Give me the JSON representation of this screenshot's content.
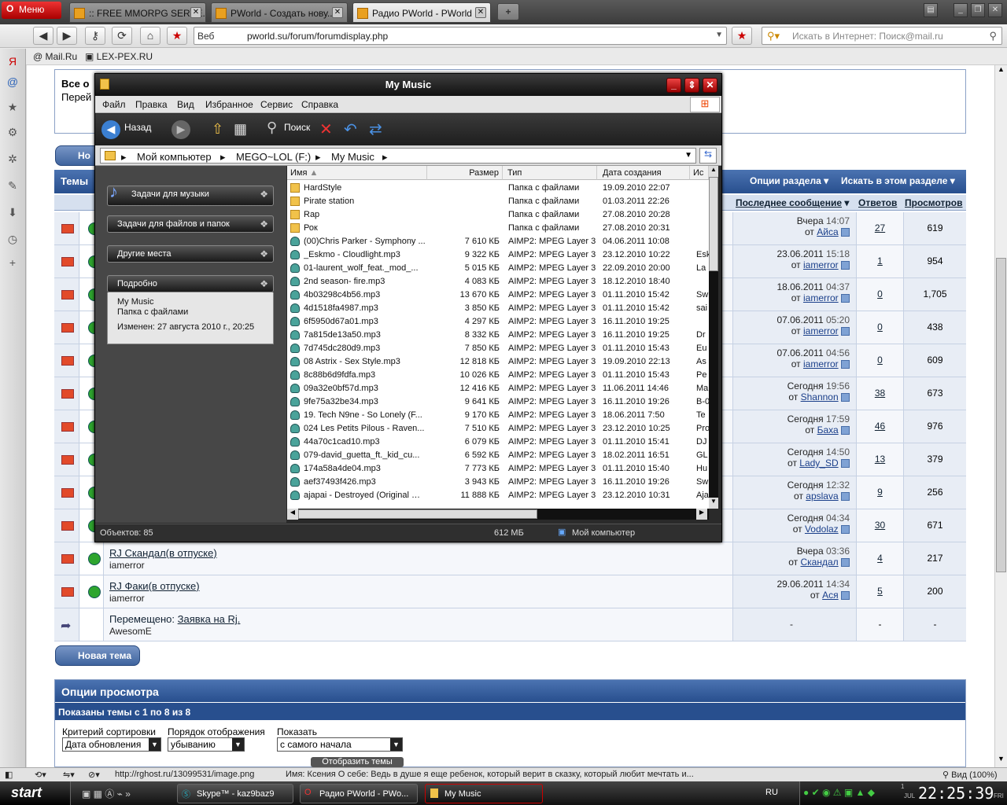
{
  "browser": {
    "menu_label": "Меню",
    "tabs": [
      {
        "label": ":: FREE MMORPG SERVE..."
      },
      {
        "label": "PWorld - Создать нову..."
      },
      {
        "label": "Радио PWorld - PWorld"
      }
    ],
    "url_prefix": "Веб",
    "url": "pworld.su/forum/forumdisplay.php",
    "search_placeholder": "Искать в Интернет: Поиск@mail.ru",
    "bookmarks": [
      "Mail.Ru",
      "LEX-PEX.RU"
    ]
  },
  "forum": {
    "notice_line1": "Все о",
    "notice_line2": "Перей",
    "threads_head_label": "Темы",
    "new_thread_partial": "Но",
    "section_options": "Опции раздела",
    "search_section": "Искать в этом разделе",
    "col_last_post": "Последнее сообщение",
    "col_replies": "Ответов",
    "col_views": "Просмотров",
    "rows": [
      {
        "title": "",
        "author": "",
        "date": "Вчера",
        "time": "14:07",
        "by_prefix": "от",
        "by": "Айса",
        "replies": "27",
        "views": "619"
      },
      {
        "title": "",
        "author": "",
        "date": "23.06.2011",
        "time": "15:18",
        "by_prefix": "от",
        "by": "iamerror",
        "replies": "1",
        "views": "954"
      },
      {
        "title": "",
        "author": "",
        "date": "18.06.2011",
        "time": "04:37",
        "by_prefix": "от",
        "by": "iamerror",
        "replies": "0",
        "views": "1,705"
      },
      {
        "title": "",
        "author": "",
        "date": "07.06.2011",
        "time": "05:20",
        "by_prefix": "от",
        "by": "iamerror",
        "replies": "0",
        "views": "438"
      },
      {
        "title": "",
        "author": "",
        "date": "07.06.2011",
        "time": "04:56",
        "by_prefix": "от",
        "by": "iamerror",
        "replies": "0",
        "views": "609"
      },
      {
        "title": "",
        "author": "",
        "date": "Сегодня",
        "time": "19:56",
        "by_prefix": "от",
        "by": "Shannon",
        "replies": "38",
        "views": "673"
      },
      {
        "title": "",
        "author": "",
        "date": "Сегодня",
        "time": "17:59",
        "by_prefix": "от",
        "by": "Баха",
        "replies": "46",
        "views": "976"
      },
      {
        "title": "",
        "author": "",
        "date": "Сегодня",
        "time": "14:50",
        "by_prefix": "от",
        "by": "Lady_SD",
        "replies": "13",
        "views": "379"
      },
      {
        "title": "",
        "author": "",
        "date": "Сегодня",
        "time": "12:32",
        "by_prefix": "от",
        "by": "apslava",
        "replies": "9",
        "views": "256"
      },
      {
        "title": "",
        "author": "",
        "date": "Сегодня",
        "time": "04:34",
        "by_prefix": "от",
        "by": "Vodolaz",
        "replies": "30",
        "views": "671"
      },
      {
        "title": "RJ Скандал(в отпуске)",
        "author": "iamerror",
        "date": "Вчера",
        "time": "03:36",
        "by_prefix": "от",
        "by": "Скандал",
        "replies": "4",
        "views": "217"
      },
      {
        "title": "RJ Факи(в отпуске)",
        "author": "iamerror",
        "date": "29.06.2011",
        "time": "14:34",
        "by_prefix": "от",
        "by": "Ася",
        "replies": "5",
        "views": "200"
      }
    ],
    "moved_prefix": "Перемещено:",
    "moved_title": "Заявка на Rj.",
    "moved_author": "AwesomE",
    "moved_dash": "-",
    "new_thread_button": "Новая тема",
    "view_options_title": "Опции просмотра",
    "shown_threads": "Показаны темы с 1 по 8 из 8",
    "sort_label": "Критерий сортировки",
    "sort_value": "Дата обновления",
    "order_label": "Порядок отображения",
    "order_value": "убыванию",
    "show_label": "Показать",
    "show_value": "с самого начала",
    "show_button": "Отобразить темы"
  },
  "explorer": {
    "title": "My Music",
    "menu": [
      "Файл",
      "Правка",
      "Вид",
      "Избранное",
      "Сервис",
      "Справка"
    ],
    "back_label": "Назад",
    "search_label": "Поиск",
    "breadcrumbs": [
      "Мой компьютер",
      "MEGO~LOL (F:)",
      "My Music"
    ],
    "tasks": [
      "Задачи для музыки",
      "Задачи для файлов и папок",
      "Другие места",
      "Подробно"
    ],
    "detail_name": "My Music",
    "detail_type": "Папка с файлами",
    "detail_modified": "Изменен: 27 августа 2010 г., 20:25",
    "columns": {
      "name": "Имя",
      "size": "Размер",
      "type": "Тип",
      "created": "Дата создания",
      "extra": "Ис"
    },
    "files": [
      {
        "icon": "folder",
        "name": "HardStyle",
        "size": "",
        "type": "Папка с файлами",
        "created": "19.09.2010 22:07",
        "extra": ""
      },
      {
        "icon": "folder",
        "name": "Pirate station",
        "size": "",
        "type": "Папка с файлами",
        "created": "01.03.2011 22:26",
        "extra": ""
      },
      {
        "icon": "folder",
        "name": "Rap",
        "size": "",
        "type": "Папка с файлами",
        "created": "27.08.2010 20:28",
        "extra": ""
      },
      {
        "icon": "folder",
        "name": "Рок",
        "size": "",
        "type": "Папка с файлами",
        "created": "27.08.2010 20:31",
        "extra": ""
      },
      {
        "icon": "audio",
        "name": "(00)Chris Parker - Symphony ...",
        "size": "7 610 КБ",
        "type": "AIMP2: MPEG Layer 3",
        "created": "04.06.2011 10:08",
        "extra": ""
      },
      {
        "icon": "audio",
        "name": "_Eskmo - Cloudlight.mp3",
        "size": "9 322 КБ",
        "type": "AIMP2: MPEG Layer 3",
        "created": "23.12.2010 10:22",
        "extra": "Esk"
      },
      {
        "icon": "audio",
        "name": "01-laurent_wolf_feat._mod_...",
        "size": "5 015 КБ",
        "type": "AIMP2: MPEG Layer 3",
        "created": "22.09.2010 20:00",
        "extra": "La"
      },
      {
        "icon": "audio",
        "name": "2nd season- fire.mp3",
        "size": "4 083 КБ",
        "type": "AIMP2: MPEG Layer 3",
        "created": "18.12.2010 18:40",
        "extra": ""
      },
      {
        "icon": "audio",
        "name": "4b03298c4b56.mp3",
        "size": "13 670 КБ",
        "type": "AIMP2: MPEG Layer 3",
        "created": "01.11.2010 15:42",
        "extra": "Sw"
      },
      {
        "icon": "audio",
        "name": "4d1518fa4987.mp3",
        "size": "3 850 КБ",
        "type": "AIMP2: MPEG Layer 3",
        "created": "01.11.2010 15:42",
        "extra": "sai"
      },
      {
        "icon": "audio",
        "name": "6f5950d67a01.mp3",
        "size": "4 297 КБ",
        "type": "AIMP2: MPEG Layer 3",
        "created": "16.11.2010 19:25",
        "extra": ""
      },
      {
        "icon": "audio",
        "name": "7a815de13a50.mp3",
        "size": "8 332 КБ",
        "type": "AIMP2: MPEG Layer 3",
        "created": "16.11.2010 19:25",
        "extra": "Dr"
      },
      {
        "icon": "audio",
        "name": "7d745dc280d9.mp3",
        "size": "7 850 КБ",
        "type": "AIMP2: MPEG Layer 3",
        "created": "01.11.2010 15:43",
        "extra": "Eu"
      },
      {
        "icon": "audio",
        "name": "08 Astrix - Sex Style.mp3",
        "size": "12 818 КБ",
        "type": "AIMP2: MPEG Layer 3",
        "created": "19.09.2010 22:13",
        "extra": "As"
      },
      {
        "icon": "audio",
        "name": "8c88b6d9fdfa.mp3",
        "size": "10 026 КБ",
        "type": "AIMP2: MPEG Layer 3",
        "created": "01.11.2010 15:43",
        "extra": "Pe"
      },
      {
        "icon": "audio",
        "name": "09a32e0bf57d.mp3",
        "size": "12 416 КБ",
        "type": "AIMP2: MPEG Layer 3",
        "created": "11.06.2011 14:46",
        "extra": "Ma"
      },
      {
        "icon": "audio",
        "name": "9fe75a32be34.mp3",
        "size": "9 641 КБ",
        "type": "AIMP2: MPEG Layer 3",
        "created": "16.11.2010 19:26",
        "extra": "B-0"
      },
      {
        "icon": "audio",
        "name": "19. Tech N9ne - So Lonely (F...",
        "size": "9 170 КБ",
        "type": "AIMP2: MPEG Layer 3",
        "created": "18.06.2011 7:50",
        "extra": "Te"
      },
      {
        "icon": "audio",
        "name": "024 Les Petits Pilous - Raven...",
        "size": "7 510 КБ",
        "type": "AIMP2: MPEG Layer 3",
        "created": "23.12.2010 10:25",
        "extra": "Pro"
      },
      {
        "icon": "audio",
        "name": "44a70c1cad10.mp3",
        "size": "6 079 КБ",
        "type": "AIMP2: MPEG Layer 3",
        "created": "01.11.2010 15:41",
        "extra": "DJ"
      },
      {
        "icon": "audio",
        "name": "079-david_guetta_ft._kid_cu...",
        "size": "6 592 КБ",
        "type": "AIMP2: MPEG Layer 3",
        "created": "18.02.2011 16:51",
        "extra": "GL"
      },
      {
        "icon": "audio",
        "name": "174a58a4de04.mp3",
        "size": "7 773 КБ",
        "type": "AIMP2: MPEG Layer 3",
        "created": "01.11.2010 15:40",
        "extra": "Hu"
      },
      {
        "icon": "audio",
        "name": "aef37493f426.mp3",
        "size": "3 943 КБ",
        "type": "AIMP2: MPEG Layer 3",
        "created": "16.11.2010 19:26",
        "extra": "Sw"
      },
      {
        "icon": "audio",
        "name": "ajapai - Destroyed (Original M...",
        "size": "11 888 КБ",
        "type": "AIMP2: MPEG Layer 3",
        "created": "23.12.2010 10:31",
        "extra": "Aja"
      }
    ],
    "status_count": "Объектов: 85",
    "status_size": "612 МБ",
    "status_location": "Мой компьютер"
  },
  "opera_status": {
    "url": "http://rghost.ru/13099531/image.png",
    "text": "Имя:  Ксения   О себе:  Ведь в душе я еще ребенок, который верит в сказку, который любит мечтать и...",
    "zoom": "Вид (100%)"
  },
  "taskbar": {
    "start": "start",
    "tasks": [
      "Skype™ - kaz9baz9",
      "Радио PWorld - PWo...",
      "My Music"
    ],
    "lang": "RU",
    "clock": "22:25:39",
    "date_month": "JUL",
    "date_day": "1",
    "weekday": "FRI"
  }
}
